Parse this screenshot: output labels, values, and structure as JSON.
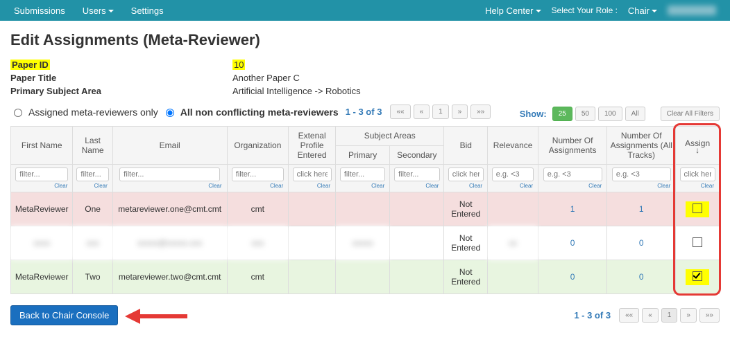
{
  "topbar": {
    "left": [
      "Submissions",
      "Users",
      "Settings"
    ],
    "help": "Help Center",
    "role_label": "Select Your Role :",
    "role_value": "Chair"
  },
  "title": "Edit Assignments (Meta-Reviewer)",
  "meta": {
    "paper_id_label": "Paper ID",
    "paper_id_value": "10",
    "paper_title_label": "Paper Title",
    "paper_title_value": "Another Paper C",
    "subject_label": "Primary Subject Area",
    "subject_value": "Artificial Intelligence -> Robotics"
  },
  "radio": {
    "assigned": "Assigned meta-reviewers only",
    "all": "All non conflicting meta-reviewers"
  },
  "pager": {
    "info": "1 - 3 of 3",
    "first": "««",
    "prev": "«",
    "page": "1",
    "next": "»",
    "last": "»»"
  },
  "show": {
    "label": "Show:",
    "opts": [
      "25",
      "50",
      "100",
      "All"
    ],
    "clear_all": "Clear All Filters"
  },
  "headers": {
    "first": "First Name",
    "last": "Last Name",
    "email": "Email",
    "org": "Organization",
    "ext": "Extenal Profile Entered",
    "subj": "Subject Areas",
    "primary": "Primary",
    "secondary": "Secondary",
    "bid": "Bid",
    "rel": "Relevance",
    "num": "Number Of Assignments",
    "numall": "Number Of Assignments (All Tracks)",
    "assign": "Assign"
  },
  "filters": {
    "generic": "filter...",
    "click": "click here",
    "eg": "e.g. <3",
    "clear": "Clear"
  },
  "rows": [
    {
      "first": "MetaReviewer",
      "last": "One",
      "email": "metareviewer.one@cmt.cmt",
      "org": "cmt",
      "ext": "",
      "primary": "",
      "secondary": "",
      "bid": "Not Entered",
      "rel": "",
      "num": "1",
      "numall": "1",
      "checked": false,
      "highlight": true,
      "blurred": false
    },
    {
      "first": "",
      "last": "",
      "email": "",
      "org": "",
      "ext": "",
      "primary": "",
      "secondary": "",
      "bid": "Not Entered",
      "rel": "",
      "num": "0",
      "numall": "0",
      "checked": false,
      "highlight": false,
      "blurred": true
    },
    {
      "first": "MetaReviewer",
      "last": "Two",
      "email": "metareviewer.two@cmt.cmt",
      "org": "cmt",
      "ext": "",
      "primary": "",
      "secondary": "",
      "bid": "Not Entered",
      "rel": "",
      "num": "0",
      "numall": "0",
      "checked": true,
      "highlight": true,
      "blurred": false
    }
  ],
  "footer": {
    "back": "Back to Chair Console"
  }
}
